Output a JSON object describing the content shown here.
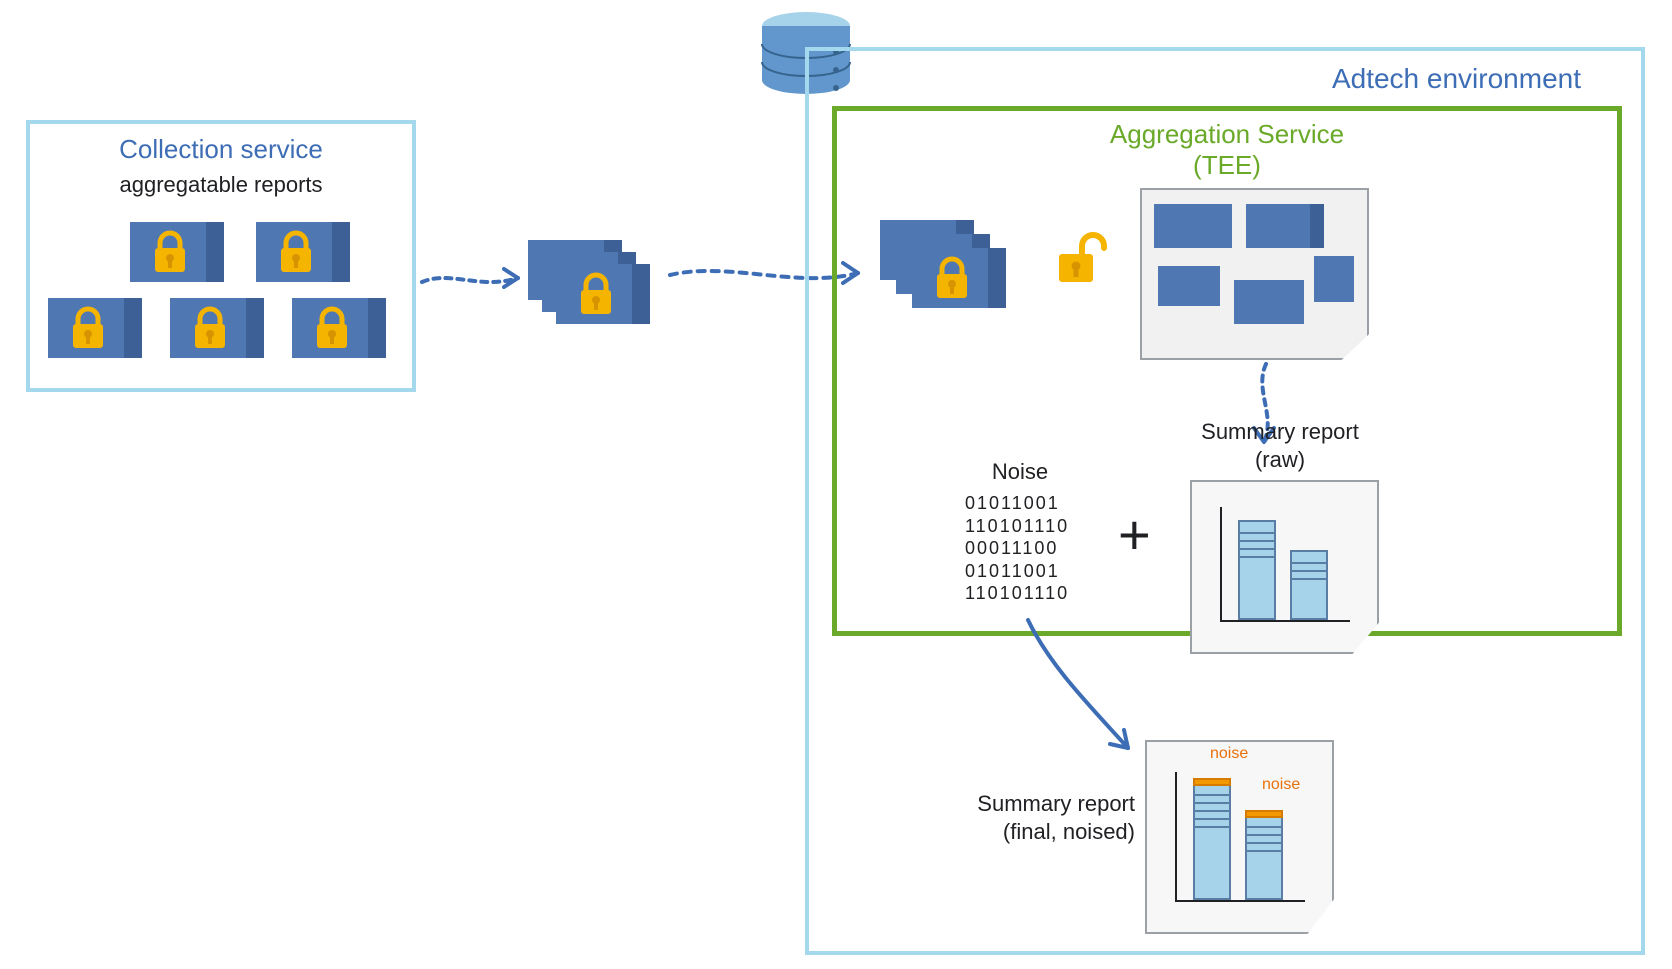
{
  "collection": {
    "title": "Collection service",
    "subtitle": "aggregatable reports"
  },
  "adtech": {
    "title": "Adtech environment"
  },
  "tee": {
    "title_line1": "Aggregation Service",
    "title_line2": "(TEE)"
  },
  "noise": {
    "label": "Noise",
    "lines": [
      "01011001",
      "110101110",
      "00011100",
      "01011001",
      "110101110"
    ]
  },
  "plus": "+",
  "summary_raw": {
    "label_line1": "Summary report",
    "label_line2": "(raw)"
  },
  "summary_final": {
    "label_line1": "Summary report",
    "label_line2": "(final, noised)",
    "noise_label": "noise"
  },
  "icons": {
    "database": "database-icon",
    "lock_closed": "lock-closed-icon",
    "lock_open": "lock-open-icon"
  }
}
